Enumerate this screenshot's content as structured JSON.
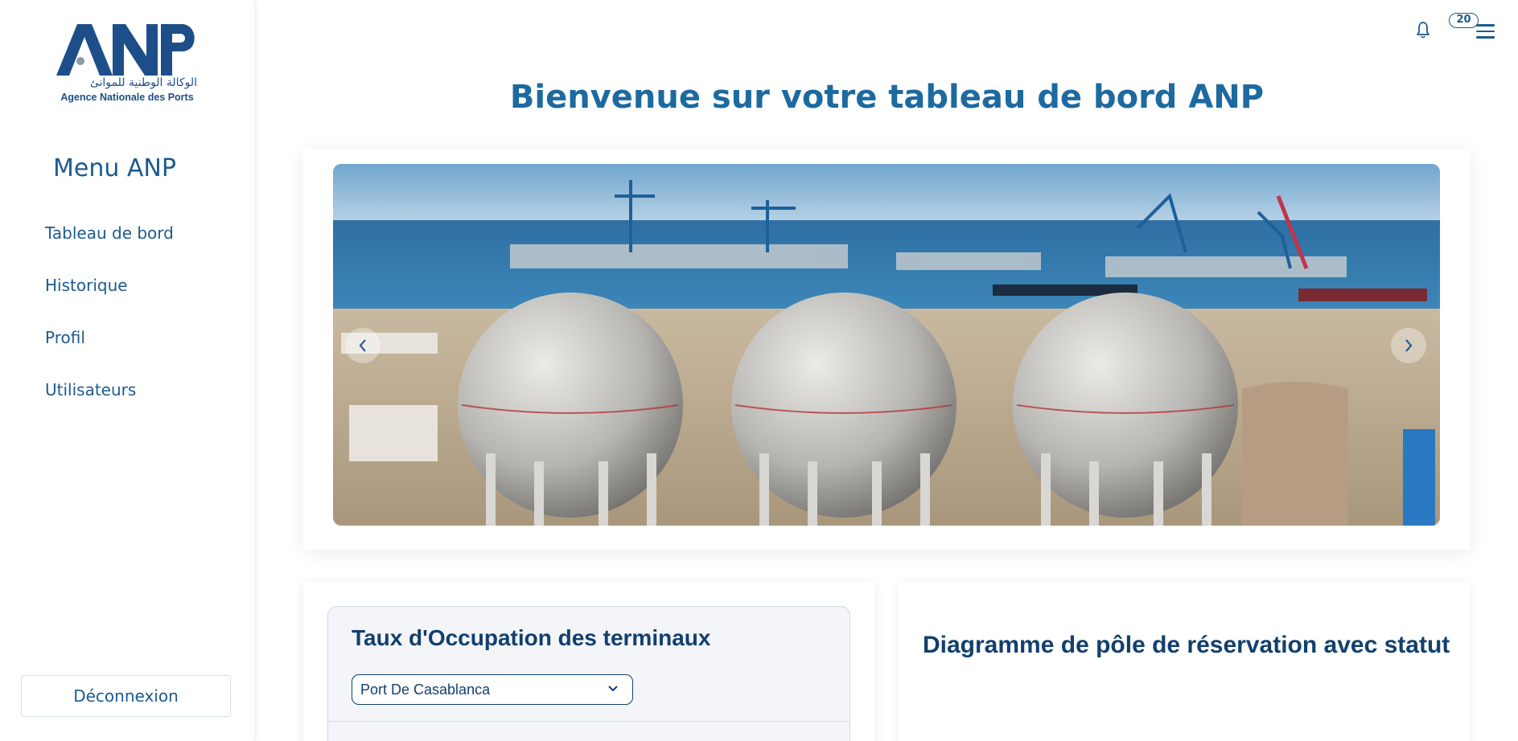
{
  "brand": {
    "logo_text": "ANP",
    "arabic_name": "الوكالة الوطنية للموانئ",
    "subtitle": "Agence Nationale des Ports",
    "primary_color": "#1c5b8f",
    "dark_color": "#123f6e"
  },
  "sidebar": {
    "title": "Menu ANP",
    "items": [
      {
        "label": "Tableau de bord"
      },
      {
        "label": "Historique"
      },
      {
        "label": "Profil"
      },
      {
        "label": "Utilisateurs"
      }
    ],
    "logout_label": "Déconnexion"
  },
  "topbar": {
    "bell_icon": "bell-icon",
    "notification_count": "20",
    "menu_icon": "hamburger-icon"
  },
  "main": {
    "title": "Bienvenue sur votre tableau de bord ANP",
    "carousel": {
      "image_subject": "port gas storage spheres",
      "prev_icon": "chevron-left-icon",
      "next_icon": "chevron-right-icon"
    },
    "occupancy": {
      "title": "Taux d'Occupation des terminaux",
      "selected_port": "Port De Casablanca"
    },
    "diagram": {
      "title": "Diagramme de pôle de réservation avec statut"
    }
  }
}
